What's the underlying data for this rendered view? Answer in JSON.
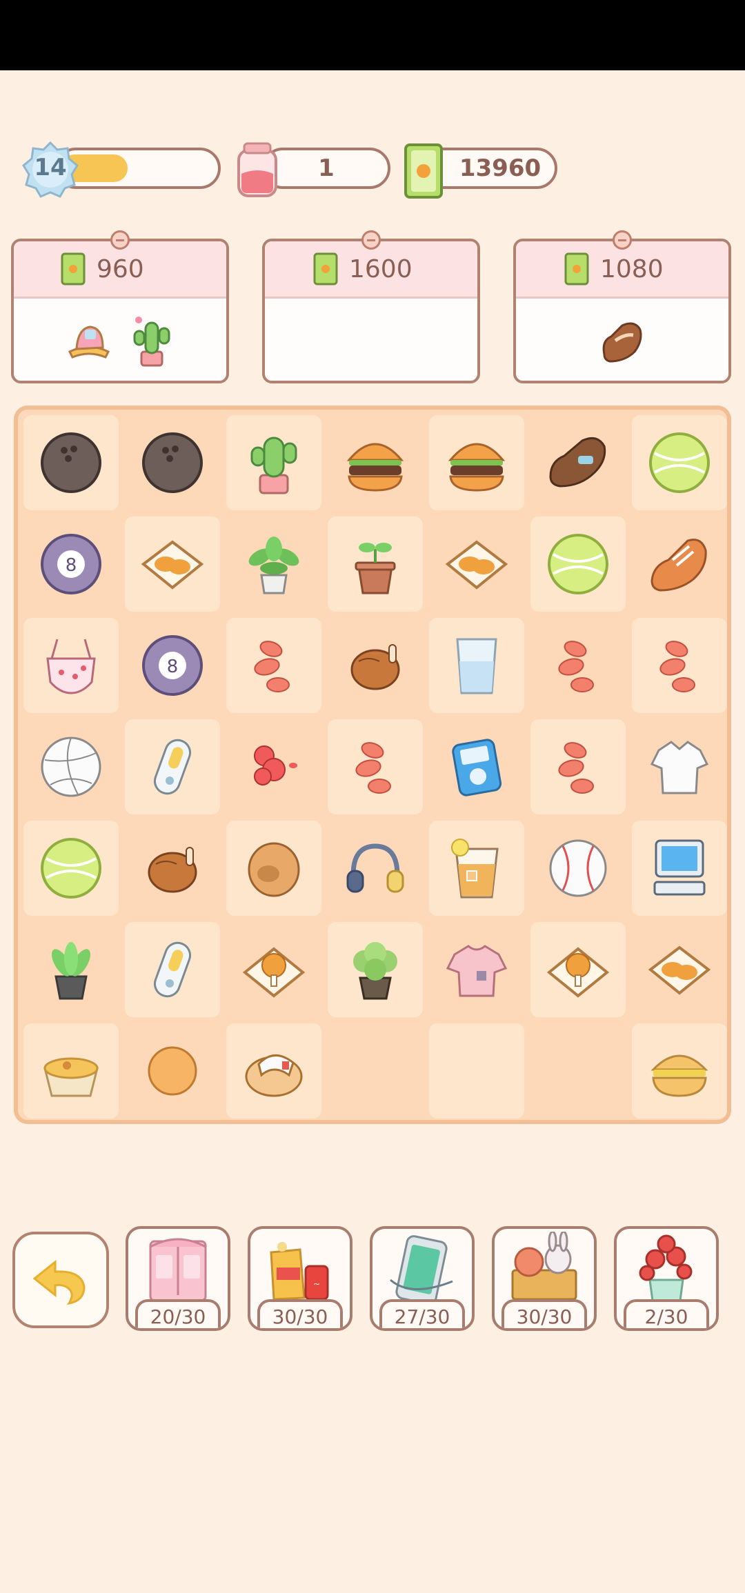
{
  "status_bar": {},
  "hud": {
    "level": "14",
    "level_progress": 0.42,
    "energy": "1",
    "cash": "13960"
  },
  "orders": [
    {
      "price": "960",
      "items": [
        "bucket-hat-icon",
        "cactus-icon"
      ]
    },
    {
      "price": "1600",
      "items": []
    },
    {
      "price": "1080",
      "items": [
        "brown-shoe-icon"
      ]
    }
  ],
  "board": {
    "rows": [
      [
        "bowling-ball",
        "bowling-ball",
        "cactus",
        "burger",
        "burger",
        "loafer",
        "tennis-ball"
      ],
      [
        "eight-ball",
        "fried-food-tray",
        "potted-plant",
        "seedling",
        "fried-food-tray",
        "tennis-ball",
        "sneaker"
      ],
      [
        "swimsuit",
        "eight-ball",
        "sweet-potato",
        "roast-chicken",
        "water-glass",
        "sweet-potato",
        "sweet-potato"
      ],
      [
        "volleyball",
        "mp3-player",
        "raspberry-cluster",
        "sweet-potato",
        "ipod",
        "sweet-potato",
        "white-shirt"
      ],
      [
        "tennis-ball",
        "roast-chicken",
        "clog",
        "headphones",
        "iced-drink",
        "baseball",
        "computer"
      ],
      [
        "succulent",
        "mp3-player",
        "fried-chicken-tray",
        "leafy-plant",
        "pink-tshirt",
        "fried-chicken-tray",
        "fried-food-tray"
      ],
      [
        "egg-tart",
        "ping-pong-ball",
        "slipper",
        "",
        "",
        "",
        "cheeseburger"
      ]
    ]
  },
  "collections": [
    {
      "icon": "wardrobe-icon",
      "count": "20/30"
    },
    {
      "icon": "snacks-drink-icon",
      "count": "30/30"
    },
    {
      "icon": "phone-icon",
      "count": "27/30"
    },
    {
      "icon": "toy-box-icon",
      "count": "30/30"
    },
    {
      "icon": "flower-vase-icon",
      "count": "2/30"
    }
  ],
  "colors": {
    "background": "#fdf0e3",
    "board": "#fdd9b9",
    "board_border": "#f2bf95",
    "progress_fill": "#f7c553",
    "text_brown": "#8a5e52"
  }
}
